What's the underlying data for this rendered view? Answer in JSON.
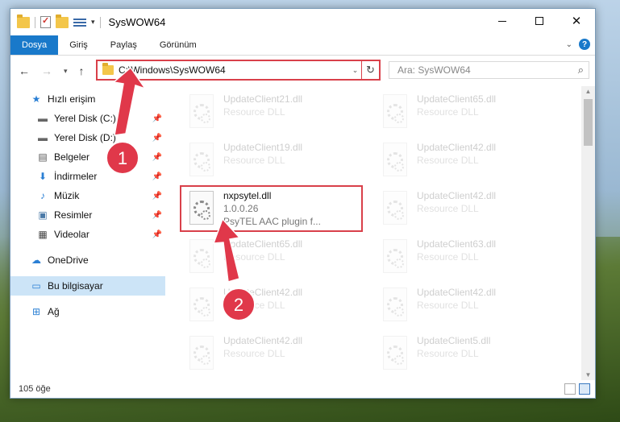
{
  "window": {
    "title": "SysWOW64"
  },
  "ribbon": {
    "tabs": [
      "Dosya",
      "Giriş",
      "Paylaş",
      "Görünüm"
    ],
    "help": "?"
  },
  "address": {
    "path": "C:\\Windows\\SysWOW64",
    "search_placeholder": "Ara: SysWOW64"
  },
  "sidebar": {
    "quick_access": "Hızlı erişim",
    "items": [
      {
        "label": "Yerel Disk (C:)",
        "icon": "drive-icon"
      },
      {
        "label": "Yerel Disk (D:)",
        "icon": "drive-icon"
      },
      {
        "label": "Belgeler",
        "icon": "documents-icon"
      },
      {
        "label": "İndirmeler",
        "icon": "downloads-icon"
      },
      {
        "label": "Müzik",
        "icon": "music-icon"
      },
      {
        "label": "Resimler",
        "icon": "pictures-icon"
      },
      {
        "label": "Videolar",
        "icon": "videos-icon"
      }
    ],
    "onedrive": "OneDrive",
    "this_pc": "Bu bilgisayar",
    "network": "Ağ"
  },
  "files": {
    "left": [
      {
        "name": "UpdateClient21.dll",
        "desc": "Resource DLL"
      },
      {
        "name": "UpdateClient19.dll",
        "desc": "Resource DLL"
      },
      {
        "name": "nxpsytel.dll",
        "desc": "1.0.0.26",
        "desc2": "PsyTEL AAC plugin f..."
      },
      {
        "name": "UpdateClient65.dll",
        "desc": "Resource DLL"
      },
      {
        "name": "UpdateClient42.dll",
        "desc": "Resource DLL"
      },
      {
        "name": "UpdateClient42.dll",
        "desc": "Resource DLL"
      }
    ],
    "right": [
      {
        "name": "UpdateClient65.dll",
        "desc": "Resource DLL"
      },
      {
        "name": "UpdateClient42.dll",
        "desc": "Resource DLL"
      },
      {
        "name": "UpdateClient42.dll",
        "desc": "Resource DLL"
      },
      {
        "name": "UpdateClient63.dll",
        "desc": "Resource DLL"
      },
      {
        "name": "UpdateClient42.dll",
        "desc": "Resource DLL"
      },
      {
        "name": "UpdateClient5.dll",
        "desc": "Resource DLL"
      }
    ]
  },
  "status": {
    "count": "105 öğe"
  },
  "annotations": {
    "step1": "1",
    "step2": "2",
    "color": "#e0384a"
  }
}
